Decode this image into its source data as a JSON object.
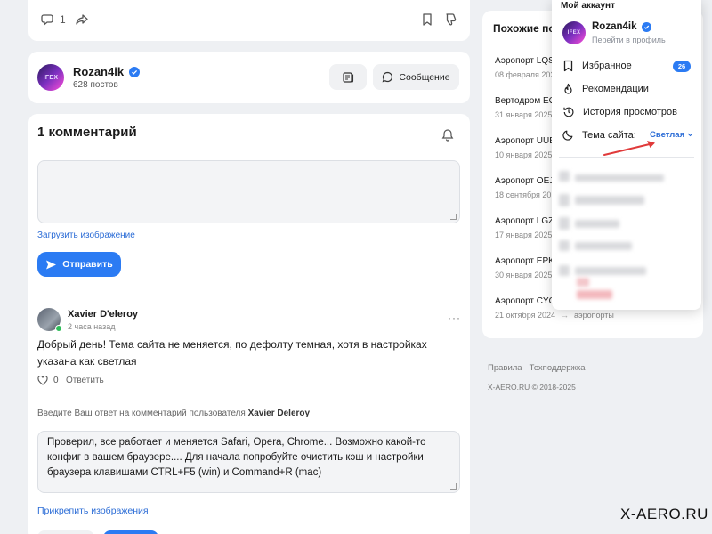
{
  "post_actions": {
    "comment_count": "1"
  },
  "author": {
    "name": "Rozan4ik",
    "posts": "628 постов",
    "avatar_text": "IFEX",
    "message_button": "Сообщение"
  },
  "comments": {
    "title": "1 комментарий",
    "upload_link": "Загрузить изображение",
    "send_button": "Отправить",
    "comment": {
      "author": "Xavier D'eleroy",
      "time": "2 часа назад",
      "text": "Добрый день! Тема сайта не меняется, по дефолту темная, хотя в настройках указана как светлая",
      "likes": "0",
      "reply": "Ответить"
    },
    "reply_prompt_prefix": "Введите Ваш ответ на комментарий пользователя ",
    "reply_prompt_user": "Xavier Deleroy",
    "reply_text": "Проверил, все работает и меняется Safari, Opera, Chrome... Возможно какой-то конфиг в вашем браузере.... Для начала попробуйте очистить кэш и настройки браузера клавишами CTRL+F5 (win) и Command+R (mac)",
    "attach_link": "Прикрепить изображения"
  },
  "similar": {
    "title": "Похожие по",
    "items": [
      {
        "title": "Аэропорт LQS",
        "date": "08 февраля 202"
      },
      {
        "title": "Вертодром EG",
        "date": "31 января 2025"
      },
      {
        "title": "Аэропорт UUB",
        "date": "10 января 2025"
      },
      {
        "title": "Аэропорт OEJ",
        "date": "18 сентября 20"
      },
      {
        "title": "Аэропорт LGZ",
        "date": "17 января 2025"
      },
      {
        "title": "Аэропорт EPK",
        "date": "30 января 2025"
      },
      {
        "title": "Аэропорт CYQ",
        "date": "21 октября 2024",
        "tag": "аэропорты"
      }
    ],
    "footer_links": [
      "Правила",
      "Техподдержка",
      "···"
    ],
    "copyright": "X-AERO.RU © 2018-2025"
  },
  "account_menu": {
    "title": "Мой аккаунт",
    "user_name": "Rozan4ik",
    "profile_link": "Перейти в профиль",
    "favorites": "Избранное",
    "favorites_count": "26",
    "recommendations": "Рекомендации",
    "history": "История просмотров",
    "theme_label": "Тема сайта:",
    "theme_value": "Светлая"
  },
  "watermark": "X-AERO.RU",
  "colors": {
    "accent": "#2b7bf3",
    "link": "#2b6cd6",
    "arrow": "#e03a3a"
  }
}
